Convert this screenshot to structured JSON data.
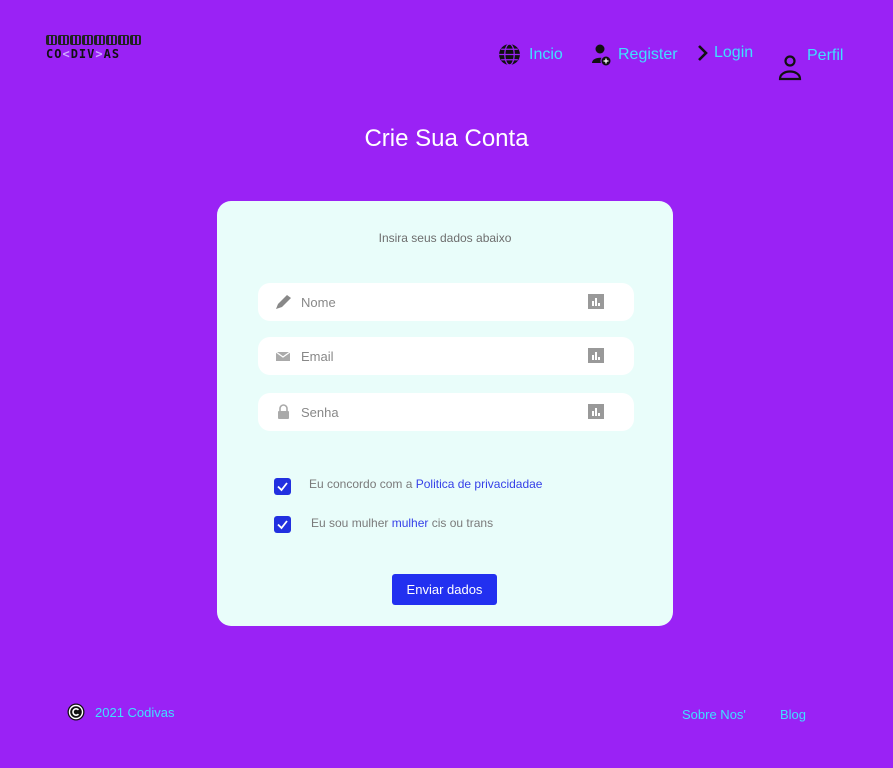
{
  "brand": {
    "logo_text_left": "CO",
    "logo_text_mid": "DIV",
    "logo_text_right": "AS"
  },
  "nav": [
    {
      "label": "Incio",
      "icon": "globe-icon"
    },
    {
      "label": "Register",
      "icon": "add-user-icon"
    },
    {
      "label": "Login",
      "icon": "chevron-right-icon"
    },
    {
      "label": "Perfil",
      "icon": "user-icon"
    }
  ],
  "page": {
    "title": "Crie Sua Conta"
  },
  "form": {
    "subtitle": "Insira seus dados abaixo",
    "fields": [
      {
        "placeholder": "Nome",
        "icon": "pencil-icon"
      },
      {
        "placeholder": "Email",
        "icon": "mail-icon"
      },
      {
        "placeholder": "Senha",
        "icon": "lock-icon"
      }
    ],
    "privacy": {
      "prefix": "Eu concordo com a ",
      "link": "Politica de privacidadae",
      "checked": true
    },
    "women": {
      "prefix": "Eu sou mulher ",
      "link": "mulher",
      "suffix": " cis ou trans",
      "checked": true
    },
    "submit_label": "Enviar dados"
  },
  "footer": {
    "copyright": "2021 Codivas",
    "links": [
      "Sobre Nos'",
      "Blog"
    ]
  },
  "colors": {
    "background": "#9a22f5",
    "accent": "#3fe0ff",
    "card": "#e9fdfa",
    "button": "#2230f0"
  }
}
